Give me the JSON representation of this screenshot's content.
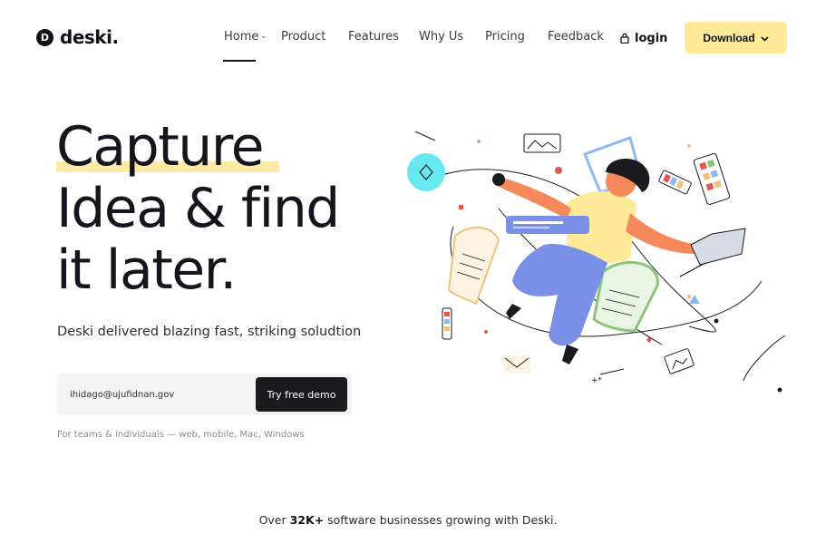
{
  "brand": {
    "logo_letter": "D",
    "name": "deski."
  },
  "nav": {
    "items": [
      {
        "label": "Home"
      },
      {
        "label": "Product"
      },
      {
        "label": "Features"
      },
      {
        "label": "Why Us"
      },
      {
        "label": "Pricing"
      },
      {
        "label": "Feedback"
      }
    ],
    "active": "Home",
    "login_label": "login",
    "download_label": "Download"
  },
  "hero": {
    "title_lines": [
      "Capture",
      "Idea & find",
      "it later."
    ],
    "subtitle": "Deski delivered blazing fast, striking soludtion",
    "email_value": "ihidago@ujufidnan.gov",
    "demo_label": "Try free demo",
    "platforms_note": "For teams & individuals — web, mobile, Mac, Windows"
  },
  "footer_stat": {
    "prefix": "Over ",
    "count": "32K+",
    "suffix": " software businesses growing with Deski."
  },
  "colors": {
    "accent_yellow": "#fde998",
    "highlight": "#fdeaa6",
    "dark": "#1b1b1f"
  },
  "icons": [
    "lock-icon",
    "chevron-down-icon"
  ]
}
